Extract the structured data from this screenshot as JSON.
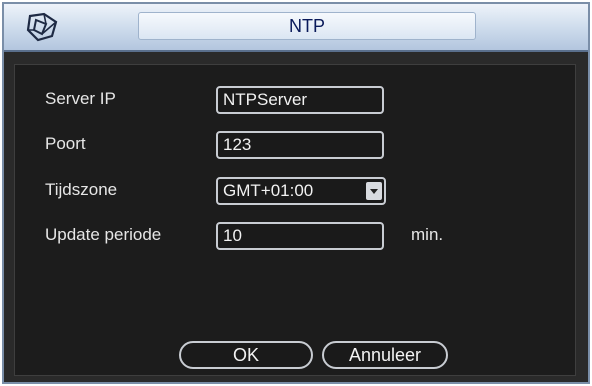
{
  "window": {
    "title": "NTP"
  },
  "form": {
    "server_ip": {
      "label": "Server IP",
      "value": "NTPServer"
    },
    "port": {
      "label": "Poort",
      "value": "123"
    },
    "timezone": {
      "label": "Tijdszone",
      "value": "GMT+01:00"
    },
    "update_period": {
      "label": "Update periode",
      "value": "10",
      "unit": "min."
    }
  },
  "buttons": {
    "ok": "OK",
    "cancel": "Annuleer"
  },
  "icons": {
    "logo": "dahua-logo-icon",
    "dropdown": "chevron-down-icon"
  }
}
